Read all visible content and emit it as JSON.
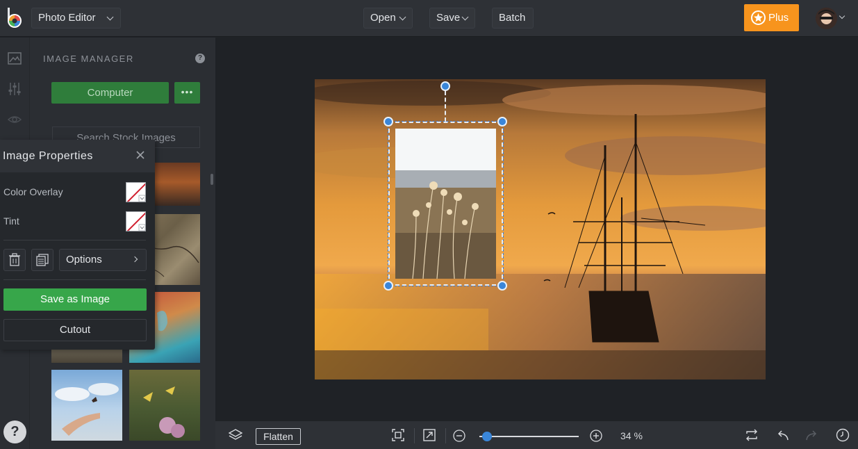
{
  "header": {
    "app_selector": "Photo Editor",
    "menu": [
      {
        "label": "Open"
      },
      {
        "label": "Save"
      },
      {
        "label": "Batch"
      }
    ],
    "plus_label": "Plus"
  },
  "rail": {
    "icons": [
      "image-icon",
      "sliders-icon",
      "eye-icon"
    ],
    "help": "?"
  },
  "image_manager": {
    "title": "IMAGE MANAGER",
    "help": "?",
    "computer_button": "Computer",
    "more_button": "•••",
    "search_placeholder": "Search Stock Images"
  },
  "image_properties": {
    "title": "Image Properties",
    "color_overlay_label": "Color Overlay",
    "tint_label": "Tint",
    "options_label": "Options",
    "save_as_image_label": "Save as Image",
    "cutout_label": "Cutout"
  },
  "bottom_bar": {
    "flatten_label": "Flatten",
    "zoom_percent": "34 %",
    "zoom_value": 0.08
  },
  "colors": {
    "accent_green": "#37a64a",
    "plus_orange": "#f7941d",
    "handle_blue": "#3a86d9"
  }
}
